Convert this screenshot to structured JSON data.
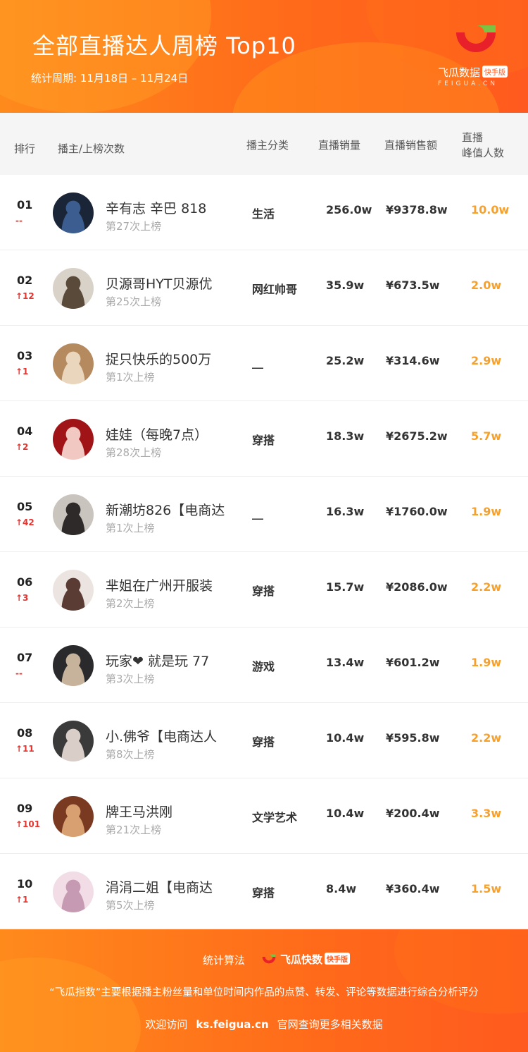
{
  "header": {
    "title": "全部直播达人周榜 Top10",
    "period": "统计周期: 11月18日 – 11月24日",
    "logo_text": "飞瓜数据",
    "logo_badge": "快手版",
    "logo_sub": "FEIGUA.CN"
  },
  "columns": {
    "rank": "排行",
    "host": "播主/上榜次数",
    "category": "播主分类",
    "sales": "直播销量",
    "amount": "直播销售额",
    "peak_line1": "直播",
    "peak_line2": "峰值人数"
  },
  "rows": [
    {
      "rank": "01",
      "change": "--",
      "name": "辛有志 辛巴 818",
      "times": "第27次上榜",
      "category": "生活",
      "sales": "256.0w",
      "amount": "¥9378.8w",
      "peak": "10.0w"
    },
    {
      "rank": "02",
      "change": "↑12",
      "name": "贝源哥HYT贝源优",
      "times": "第25次上榜",
      "category": "网红帅哥",
      "sales": "35.9w",
      "amount": "¥673.5w",
      "peak": "2.0w"
    },
    {
      "rank": "03",
      "change": "↑1",
      "name": "捉只快乐的500万",
      "times": "第1次上榜",
      "category": "__",
      "sales": "25.2w",
      "amount": "¥314.6w",
      "peak": "2.9w"
    },
    {
      "rank": "04",
      "change": "↑2",
      "name": "娃娃（每晚7点）",
      "times": "第28次上榜",
      "category": "穿搭",
      "sales": "18.3w",
      "amount": "¥2675.2w",
      "peak": "5.7w"
    },
    {
      "rank": "05",
      "change": "↑42",
      "name": "新潮坊826【电商达",
      "times": "第1次上榜",
      "category": "__",
      "sales": "16.3w",
      "amount": "¥1760.0w",
      "peak": "1.9w"
    },
    {
      "rank": "06",
      "change": "↑3",
      "name": "芈姐在广州开服装",
      "times": "第2次上榜",
      "category": "穿搭",
      "sales": "15.7w",
      "amount": "¥2086.0w",
      "peak": "2.2w"
    },
    {
      "rank": "07",
      "change": "--",
      "name": "玩家❤ 就是玩 77",
      "times": "第3次上榜",
      "category": "游戏",
      "sales": "13.4w",
      "amount": "¥601.2w",
      "peak": "1.9w"
    },
    {
      "rank": "08",
      "change": "↑11",
      "name": "小.佛爷【电商达人",
      "times": "第8次上榜",
      "category": "穿搭",
      "sales": "10.4w",
      "amount": "¥595.8w",
      "peak": "2.2w"
    },
    {
      "rank": "09",
      "change": "↑101",
      "name": "牌王马洪刚",
      "times": "第21次上榜",
      "category": "文学艺术",
      "sales": "10.4w",
      "amount": "¥200.4w",
      "peak": "3.3w"
    },
    {
      "rank": "10",
      "change": "↑1",
      "name": "涓涓二姐【电商达",
      "times": "第5次上榜",
      "category": "穿搭",
      "sales": "8.4w",
      "amount": "¥360.4w",
      "peak": "1.5w"
    }
  ],
  "footer": {
    "algo_label": "统计算法",
    "brand": "飞瓜快数",
    "brand_badge": "快手版",
    "description": "“飞瓜指数”主要根据播主粉丝量和单位时间内作品的点赞、转发、评论等数据进行综合分析评分",
    "visit_prefix": "欢迎访问",
    "visit_url": "ks.feigua.cn",
    "visit_suffix": "官网查询更多相关数据"
  },
  "colors": {
    "orange": "#ff6a1a",
    "peak": "#f7a02a",
    "rank_up": "#e8332e",
    "logo_red": "#e8202a",
    "logo_green": "#7dc243"
  }
}
